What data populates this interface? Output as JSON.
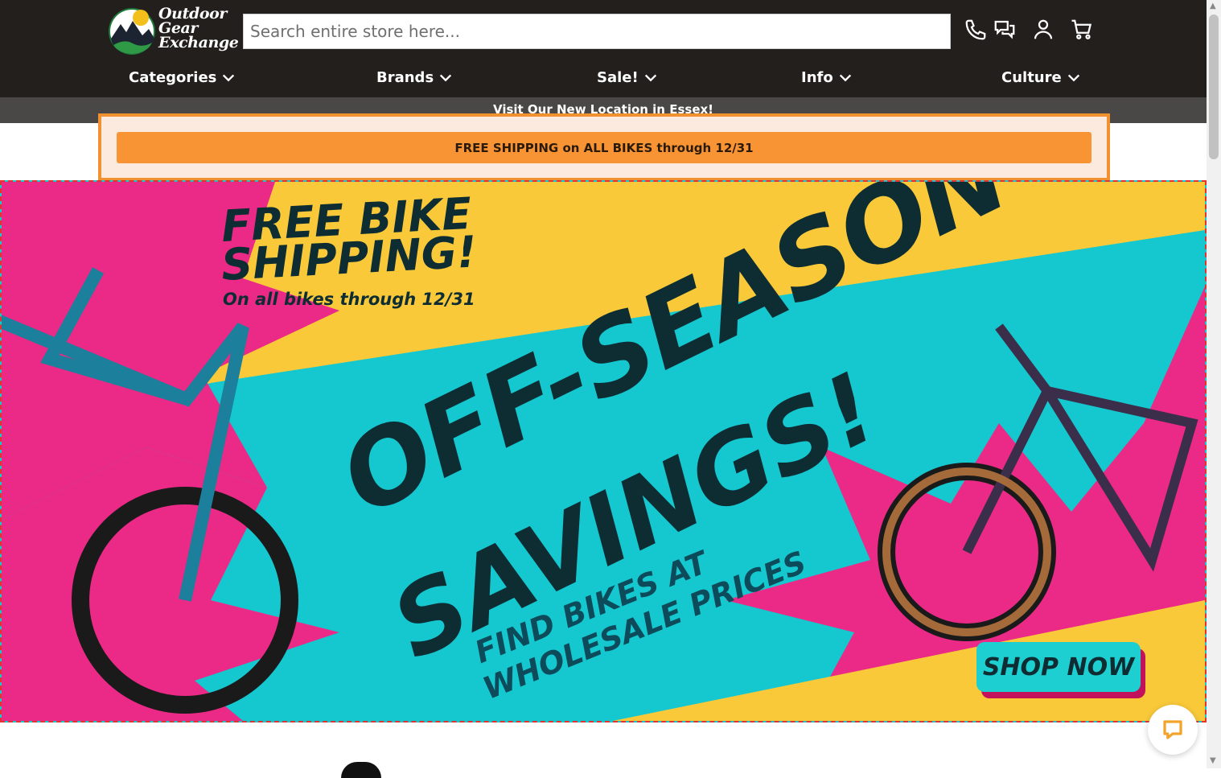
{
  "header": {
    "logo_lines": [
      "Outdoor",
      "Gear",
      "Exchange"
    ],
    "search_placeholder": "Search entire store here...",
    "icons": [
      "phone-icon",
      "chat-icon",
      "account-icon",
      "cart-icon"
    ]
  },
  "nav": {
    "items": [
      {
        "label": "Categories"
      },
      {
        "label": "Brands"
      },
      {
        "label": "Sale!"
      },
      {
        "label": "Info"
      },
      {
        "label": "Culture"
      }
    ]
  },
  "announcement": {
    "location": "Visit Our New Location in Essex!",
    "promo": "FREE SHIPPING on ALL BIKES through 12/31"
  },
  "hero": {
    "title_line1": "FREE BIKE",
    "title_line2": "SHIPPING!",
    "subtitle": "On all bikes through 12/31",
    "headline_line1": "OFF-SEASON",
    "headline_line2": "SAVINGS!",
    "tagline_line1": "FIND BIKES AT",
    "tagline_line2": "WHOLESALE PRICES",
    "cta": "SHOP NOW",
    "colors": {
      "teal": "#15c7cf",
      "pink": "#ea2a86",
      "yellow": "#f9c93a",
      "ink": "#0d2d33"
    }
  },
  "colors": {
    "header_bg": "#221f1d",
    "accent_orange": "#f99434"
  }
}
